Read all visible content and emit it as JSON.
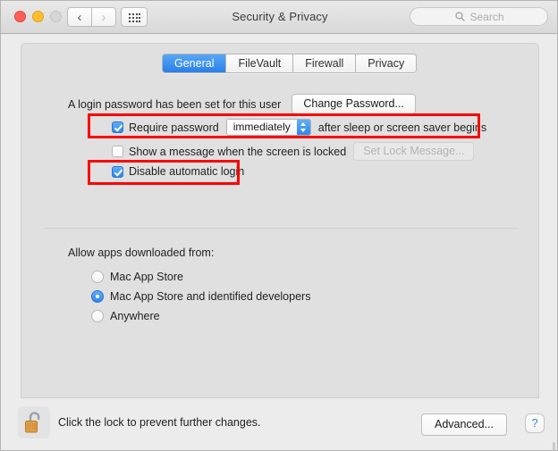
{
  "window": {
    "title": "Security & Privacy",
    "traffic_lights": [
      "close",
      "minimize",
      "zoom"
    ]
  },
  "toolbar": {
    "back_glyph": "‹",
    "forward_glyph": "›",
    "grid_icon": "show-all-icon",
    "search": {
      "placeholder": "Search",
      "icon": "search-icon"
    }
  },
  "tabs": [
    {
      "label": "General",
      "active": true
    },
    {
      "label": "FileVault",
      "active": false
    },
    {
      "label": "Firewall",
      "active": false
    },
    {
      "label": "Privacy",
      "active": false
    }
  ],
  "general": {
    "login_password_text": "A login password has been set for this user",
    "change_password_button": "Change Password...",
    "require_password": {
      "label": "Require password",
      "checked": true,
      "popup_value": "immediately",
      "suffix": "after sleep or screen saver begins",
      "highlighted": true
    },
    "show_message": {
      "label": "Show a message when the screen is locked",
      "checked": false,
      "button": "Set Lock Message...",
      "button_enabled": false
    },
    "disable_automatic_login": {
      "label": "Disable automatic login",
      "checked": true,
      "highlighted": true
    },
    "allow_apps": {
      "title": "Allow apps downloaded from:",
      "options": [
        {
          "label": "Mac App Store",
          "selected": false
        },
        {
          "label": "Mac App Store and identified developers",
          "selected": true
        },
        {
          "label": "Anywhere",
          "selected": false
        }
      ]
    }
  },
  "footer": {
    "lock_icon": "unlocked-padlock-icon",
    "lock_text": "Click the lock to prevent further changes.",
    "advanced_button": "Advanced...",
    "help_button": "?"
  },
  "colors": {
    "accent_blue": "#2f87ec",
    "highlight_red": "#ff0000",
    "window_bg": "#ececec",
    "panel_bg": "#e0e0e0",
    "lock_gold": "#e09b3d"
  }
}
